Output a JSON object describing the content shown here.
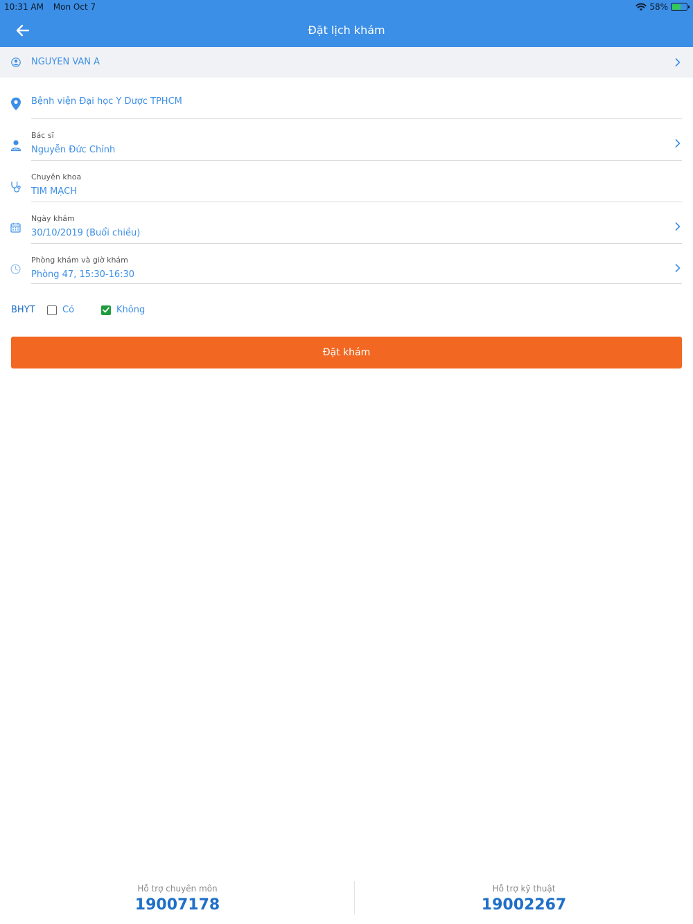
{
  "status_bar": {
    "time": "10:31 AM",
    "date": "Mon Oct 7",
    "battery": "58%",
    "battery_level": 0.58
  },
  "header": {
    "title": "Đặt lịch khám",
    "back_icon": "arrow-left-icon"
  },
  "patient": {
    "name": "NGUYEN VAN A"
  },
  "fields": {
    "hospital": {
      "value": "Bệnh viện Đại học Y Dược TPHCM"
    },
    "doctor": {
      "label": "Bác sĩ",
      "value": "Nguyễn Đức Chỉnh"
    },
    "specialty": {
      "label": "Chuyên khoa",
      "value": "TIM MẠCH"
    },
    "date": {
      "label": "Ngày khám",
      "value": "30/10/2019 (Buổi chiều)"
    },
    "room": {
      "label": "Phòng khám và giờ khám",
      "value": "Phòng 47, 15:30-16:30"
    }
  },
  "insurance": {
    "label": "BHYT",
    "options": [
      {
        "label": "Có",
        "checked": false
      },
      {
        "label": "Không",
        "checked": true
      }
    ]
  },
  "submit_label": "Đặt khám",
  "support": {
    "professional": {
      "label": "Hỗ trợ chuyên môn",
      "phone": "19007178"
    },
    "technical": {
      "label": "Hỗ trợ kỹ thuật",
      "phone": "19002267"
    }
  },
  "colors": {
    "primary": "#3c8fe6",
    "accent": "#f26722",
    "check": "#1e9c3d"
  }
}
